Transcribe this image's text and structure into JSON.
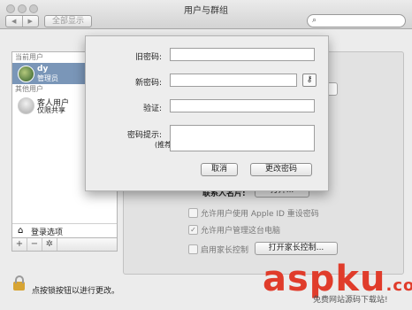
{
  "window": {
    "title": "用户与群组"
  },
  "toolbar": {
    "back": "◀",
    "forward": "▶",
    "show_all": "全部显示",
    "search_icon": "magnifier-icon"
  },
  "sidebar": {
    "current_users_header": "当前用户",
    "current_user": {
      "name": "dy",
      "role": "管理员"
    },
    "other_users_header": "其他用户",
    "guest_user": {
      "name": "客人用户",
      "role": "仅限共享"
    },
    "login_options": "登录选项",
    "add_btn": "+",
    "remove_btn": "−",
    "gear_btn": "✲"
  },
  "main": {
    "contact_card_label": "联系人名片:",
    "open_button": "打开...",
    "options": [
      {
        "label": "允许用户使用 Apple ID 重设密码",
        "checked": false
      },
      {
        "label": "允许用户管理这台电脑",
        "checked": true
      },
      {
        "label": "启用家长控制",
        "checked": false
      }
    ],
    "parental_button": "打开家长控制..."
  },
  "footer": {
    "lock_text": "点按锁按钮以进行更改。"
  },
  "sheet": {
    "old_password_label": "旧密码:",
    "new_password_label": "新密码:",
    "verify_label": "验证:",
    "hint_label": "密码提示:",
    "hint_sub": "(推荐)",
    "key_icon": "⚷",
    "cancel_button": "取消",
    "change_button": "更改密码",
    "fields": {
      "old_password": "",
      "new_password": "",
      "verify": "",
      "hint": ""
    }
  },
  "watermark": {
    "main": "aspku",
    "dot": ".com",
    "sub": "免费网站源码下载站!"
  },
  "colors": {
    "selection": "#7a96b8",
    "watermark": "#e03c2b"
  }
}
